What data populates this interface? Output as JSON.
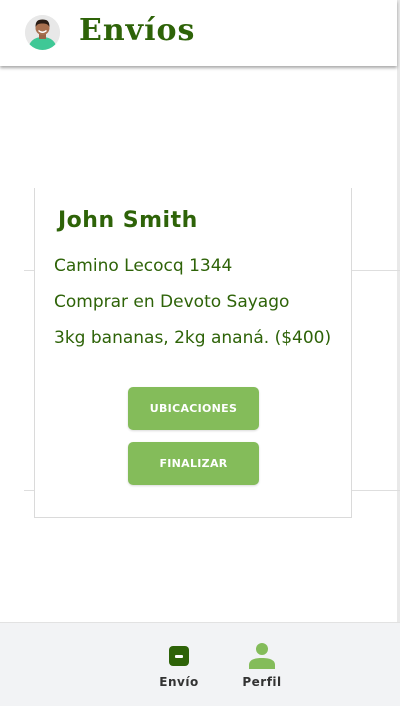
{
  "header": {
    "title": "Envíos",
    "avatar_icon": "user-avatar-photo"
  },
  "delivery": {
    "name": "John Smith",
    "address": "Camino Lecocq 1344",
    "store": "Comprar en Devoto Sayago",
    "items": "3kg bananas, 2kg ananá. ($400)"
  },
  "actions": {
    "locations_label": "UBICACIONES",
    "finish_label": "FINALIZAR"
  },
  "tabs": [
    {
      "label": "Envío",
      "icon": "package-icon",
      "color": "#2e6308"
    },
    {
      "label": "Perfil",
      "icon": "person-icon",
      "color": "#84bc5a"
    }
  ],
  "colors": {
    "primary": "#2e6308",
    "button": "#84bc5a",
    "tabbar_bg": "#f2f3f5"
  }
}
